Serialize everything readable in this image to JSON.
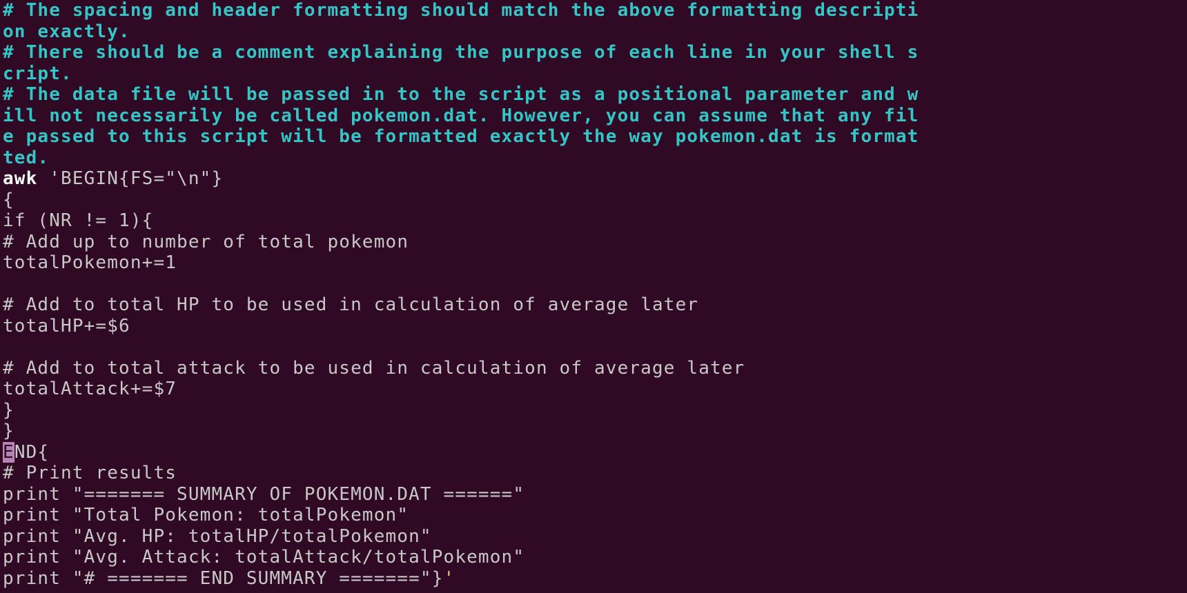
{
  "colors": {
    "background": "#300a24",
    "comment": "#34c6c6",
    "code": "#c8c8c8",
    "cursor": "#b783b5",
    "quote": "#e8c46a"
  },
  "lines": {
    "l01": "# The spacing and header formatting should match the above formatting descripti",
    "l02": "on exactly.",
    "l03": "# There should be a comment explaining the purpose of each line in your shell s",
    "l04": "cript.",
    "l05": "# The data file will be passed in to the script as a positional parameter and w",
    "l06": "ill not necessarily be called pokemon.dat. However, you can assume that any fil",
    "l07": "e passed to this script will be formatted exactly the way pokemon.dat is format",
    "l08": "ted.",
    "l09_cmd": "awk",
    "l09_rest": " 'BEGIN{FS=\"\\n\"}",
    "l10": "{",
    "l11": "if (NR != 1){",
    "l12": "# Add up to number of total pokemon",
    "l13": "totalPokemon+=1",
    "l14": "",
    "l15": "# Add to total HP to be used in calculation of average later",
    "l16": "totalHP+=$6",
    "l17": "",
    "l18": "# Add to total attack to be used in calculation of average later",
    "l19": "totalAttack+=$7",
    "l20": "}",
    "l21": "}",
    "l22_cursor": "E",
    "l22_rest": "ND{",
    "l23": "# Print results",
    "l24": "print \"======= SUMMARY OF POKEMON.DAT ======\"",
    "l25": "print \"Total Pokemon: totalPokemon\"",
    "l26": "print \"Avg. HP: totalHP/totalPokemon\"",
    "l27": "print \"Avg. Attack: totalAttack/totalPokemon\"",
    "l28_main": "print \"# ======= END SUMMARY =======\"}",
    "l28_quote": "'"
  }
}
